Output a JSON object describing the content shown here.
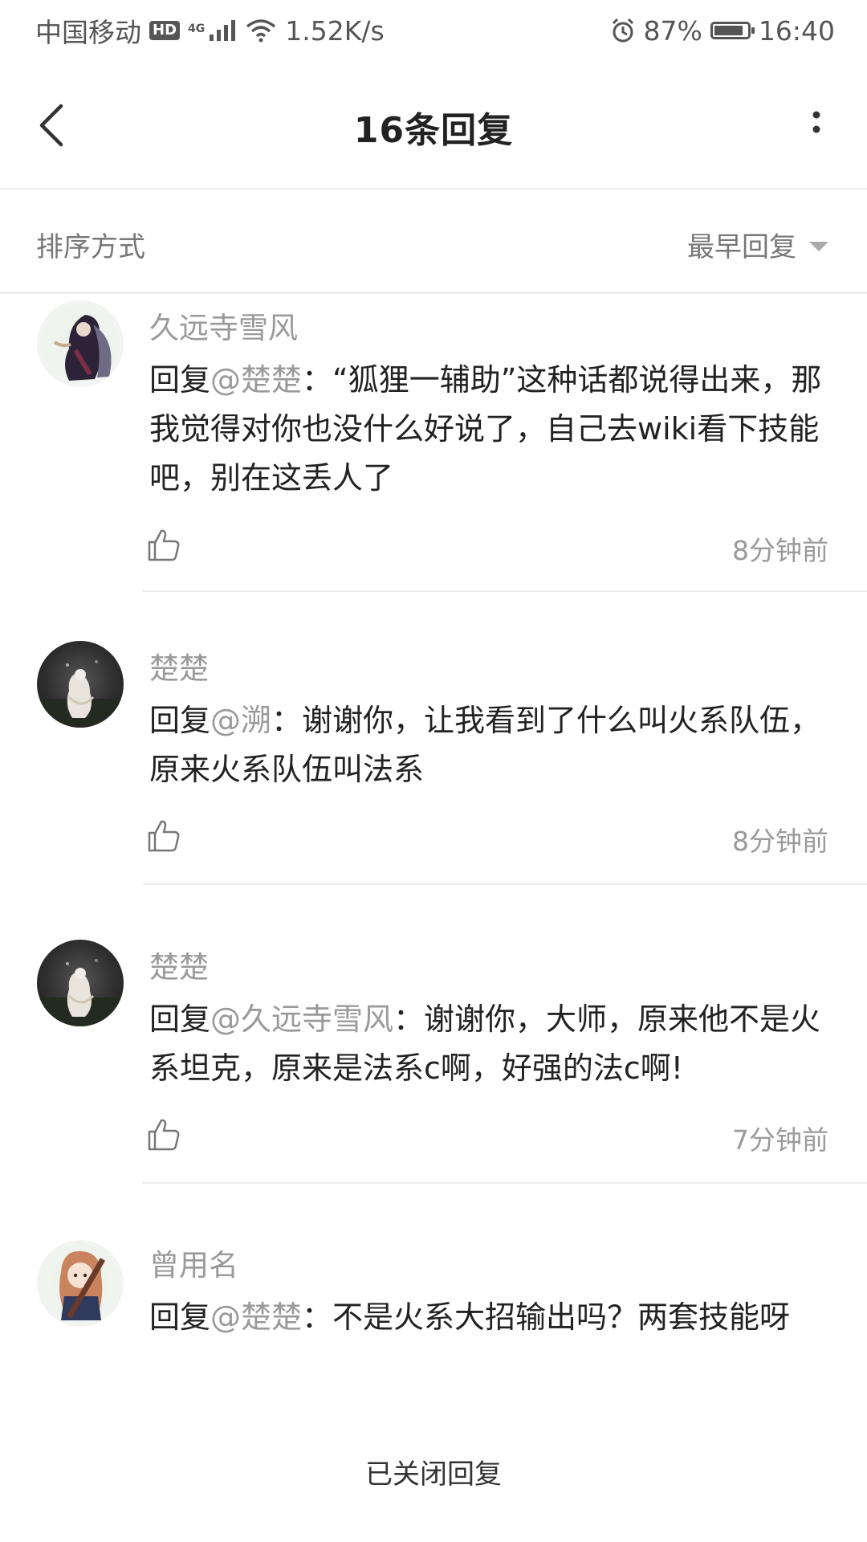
{
  "status_bar": {
    "carrier": "中国移动",
    "hd": "HD",
    "network": "4G",
    "speed": "1.52K/s",
    "battery_pct": "87%",
    "battery_level": 0.87,
    "time": "16:40"
  },
  "header": {
    "title": "16条回复"
  },
  "sort": {
    "label": "排序方式",
    "selected": "最早回复"
  },
  "replies": [
    {
      "name": "久远寺雪风",
      "prefix": "回复",
      "mention": "@楚楚",
      "text": "：“狐狸一辅助”这种话都说得出来，那我觉得对你也没什么好说了，自己去wiki看下技能吧，别在这丢人了",
      "time": "8分钟前"
    },
    {
      "name": "楚楚",
      "prefix": "回复",
      "mention": "@溯",
      "text": "：谢谢你，让我看到了什么叫火系队伍，原来火系队伍叫法系",
      "time": "8分钟前"
    },
    {
      "name": "楚楚",
      "prefix": "回复",
      "mention": "@久远寺雪风",
      "text": "：谢谢你，大师，原来他不是火系坦克，原来是法系c啊，好强的法c啊!",
      "time": "7分钟前"
    },
    {
      "name": "曾用名",
      "prefix": "回复",
      "mention": "@楚楚",
      "text": "：不是火系大招输出吗？两套技能呀",
      "time": ""
    }
  ],
  "footer": {
    "closed_note": "已关闭回复"
  },
  "colors": {
    "meta_gray": "#9a9a9a",
    "text": "#222222",
    "divider": "#ececec"
  }
}
